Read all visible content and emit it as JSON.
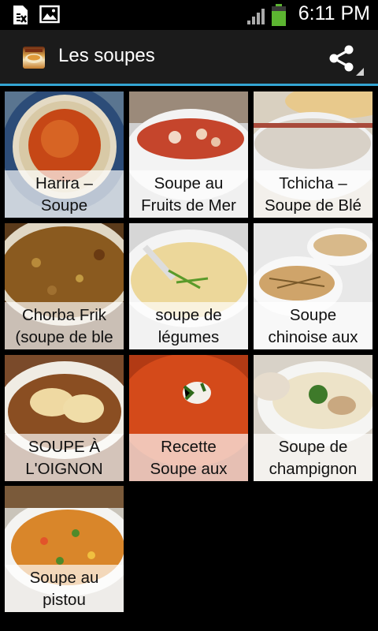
{
  "status_bar": {
    "time": "6:11 PM",
    "icons": [
      "sim-card-icon",
      "image-icon",
      "signal-icon",
      "battery-icon"
    ],
    "battery_color": "#5cb531"
  },
  "action_bar": {
    "title": "Les soupes",
    "share_icon": "share-icon",
    "accent": "#33a4d2"
  },
  "soups": [
    {
      "title": "Harira –\nSoupe"
    },
    {
      "title": "Soupe au\nFruits de Mer"
    },
    {
      "title": "Tchicha –\nSoupe de Blé"
    },
    {
      "title": "Chorba Frik\n(soupe de ble"
    },
    {
      "title": "soupe de\nlégumes"
    },
    {
      "title": "Soupe\nchinoise aux"
    },
    {
      "title": "SOUPE À\nL'OIGNON"
    },
    {
      "title": "Recette\nSoupe aux"
    },
    {
      "title": "Soupe de\nchampignon"
    },
    {
      "title": "Soupe au\npistou"
    }
  ]
}
